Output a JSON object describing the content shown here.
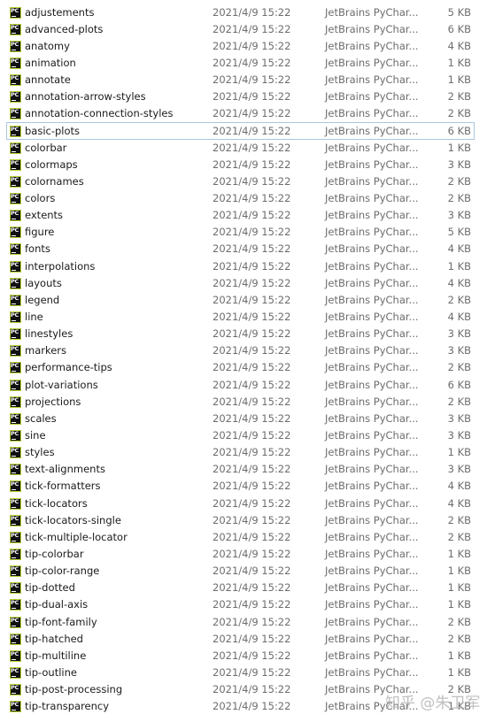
{
  "files": [
    {
      "name": "adjustements",
      "date": "2021/4/9 15:22",
      "type": "JetBrains PyChar...",
      "size": "5 KB"
    },
    {
      "name": "advanced-plots",
      "date": "2021/4/9 15:22",
      "type": "JetBrains PyChar...",
      "size": "6 KB"
    },
    {
      "name": "anatomy",
      "date": "2021/4/9 15:22",
      "type": "JetBrains PyChar...",
      "size": "4 KB"
    },
    {
      "name": "animation",
      "date": "2021/4/9 15:22",
      "type": "JetBrains PyChar...",
      "size": "1 KB"
    },
    {
      "name": "annotate",
      "date": "2021/4/9 15:22",
      "type": "JetBrains PyChar...",
      "size": "1 KB"
    },
    {
      "name": "annotation-arrow-styles",
      "date": "2021/4/9 15:22",
      "type": "JetBrains PyChar...",
      "size": "2 KB"
    },
    {
      "name": "annotation-connection-styles",
      "date": "2021/4/9 15:22",
      "type": "JetBrains PyChar...",
      "size": "2 KB"
    },
    {
      "name": "basic-plots",
      "date": "2021/4/9 15:22",
      "type": "JetBrains PyChar...",
      "size": "6 KB",
      "selected": true
    },
    {
      "name": "colorbar",
      "date": "2021/4/9 15:22",
      "type": "JetBrains PyChar...",
      "size": "1 KB"
    },
    {
      "name": "colormaps",
      "date": "2021/4/9 15:22",
      "type": "JetBrains PyChar...",
      "size": "3 KB"
    },
    {
      "name": "colornames",
      "date": "2021/4/9 15:22",
      "type": "JetBrains PyChar...",
      "size": "2 KB"
    },
    {
      "name": "colors",
      "date": "2021/4/9 15:22",
      "type": "JetBrains PyChar...",
      "size": "2 KB"
    },
    {
      "name": "extents",
      "date": "2021/4/9 15:22",
      "type": "JetBrains PyChar...",
      "size": "3 KB"
    },
    {
      "name": "figure",
      "date": "2021/4/9 15:22",
      "type": "JetBrains PyChar...",
      "size": "5 KB"
    },
    {
      "name": "fonts",
      "date": "2021/4/9 15:22",
      "type": "JetBrains PyChar...",
      "size": "4 KB"
    },
    {
      "name": "interpolations",
      "date": "2021/4/9 15:22",
      "type": "JetBrains PyChar...",
      "size": "1 KB"
    },
    {
      "name": "layouts",
      "date": "2021/4/9 15:22",
      "type": "JetBrains PyChar...",
      "size": "4 KB"
    },
    {
      "name": "legend",
      "date": "2021/4/9 15:22",
      "type": "JetBrains PyChar...",
      "size": "2 KB"
    },
    {
      "name": "line",
      "date": "2021/4/9 15:22",
      "type": "JetBrains PyChar...",
      "size": "4 KB"
    },
    {
      "name": "linestyles",
      "date": "2021/4/9 15:22",
      "type": "JetBrains PyChar...",
      "size": "3 KB"
    },
    {
      "name": "markers",
      "date": "2021/4/9 15:22",
      "type": "JetBrains PyChar...",
      "size": "3 KB"
    },
    {
      "name": "performance-tips",
      "date": "2021/4/9 15:22",
      "type": "JetBrains PyChar...",
      "size": "2 KB"
    },
    {
      "name": "plot-variations",
      "date": "2021/4/9 15:22",
      "type": "JetBrains PyChar...",
      "size": "6 KB"
    },
    {
      "name": "projections",
      "date": "2021/4/9 15:22",
      "type": "JetBrains PyChar...",
      "size": "2 KB"
    },
    {
      "name": "scales",
      "date": "2021/4/9 15:22",
      "type": "JetBrains PyChar...",
      "size": "3 KB"
    },
    {
      "name": "sine",
      "date": "2021/4/9 15:22",
      "type": "JetBrains PyChar...",
      "size": "3 KB"
    },
    {
      "name": "styles",
      "date": "2021/4/9 15:22",
      "type": "JetBrains PyChar...",
      "size": "1 KB"
    },
    {
      "name": "text-alignments",
      "date": "2021/4/9 15:22",
      "type": "JetBrains PyChar...",
      "size": "3 KB"
    },
    {
      "name": "tick-formatters",
      "date": "2021/4/9 15:22",
      "type": "JetBrains PyChar...",
      "size": "4 KB"
    },
    {
      "name": "tick-locators",
      "date": "2021/4/9 15:22",
      "type": "JetBrains PyChar...",
      "size": "4 KB"
    },
    {
      "name": "tick-locators-single",
      "date": "2021/4/9 15:22",
      "type": "JetBrains PyChar...",
      "size": "2 KB"
    },
    {
      "name": "tick-multiple-locator",
      "date": "2021/4/9 15:22",
      "type": "JetBrains PyChar...",
      "size": "2 KB"
    },
    {
      "name": "tip-colorbar",
      "date": "2021/4/9 15:22",
      "type": "JetBrains PyChar...",
      "size": "1 KB"
    },
    {
      "name": "tip-color-range",
      "date": "2021/4/9 15:22",
      "type": "JetBrains PyChar...",
      "size": "1 KB"
    },
    {
      "name": "tip-dotted",
      "date": "2021/4/9 15:22",
      "type": "JetBrains PyChar...",
      "size": "1 KB"
    },
    {
      "name": "tip-dual-axis",
      "date": "2021/4/9 15:22",
      "type": "JetBrains PyChar...",
      "size": "1 KB"
    },
    {
      "name": "tip-font-family",
      "date": "2021/4/9 15:22",
      "type": "JetBrains PyChar...",
      "size": "2 KB"
    },
    {
      "name": "tip-hatched",
      "date": "2021/4/9 15:22",
      "type": "JetBrains PyChar...",
      "size": "2 KB"
    },
    {
      "name": "tip-multiline",
      "date": "2021/4/9 15:22",
      "type": "JetBrains PyChar...",
      "size": "1 KB"
    },
    {
      "name": "tip-outline",
      "date": "2021/4/9 15:22",
      "type": "JetBrains PyChar...",
      "size": "1 KB"
    },
    {
      "name": "tip-post-processing",
      "date": "2021/4/9 15:22",
      "type": "JetBrains PyChar...",
      "size": "2 KB"
    },
    {
      "name": "tip-transparency",
      "date": "2021/4/9 15:22",
      "type": "JetBrains PyChar...",
      "size": "1 KB"
    }
  ],
  "file_icon": {
    "name": "pycharm-file-icon",
    "label": "PC"
  },
  "watermark": "知乎 @朱卫军",
  "colors": {
    "selection_border": "#a9c6e0",
    "name_text": "#1a1a1a",
    "detail_text": "#6d6d6d"
  }
}
